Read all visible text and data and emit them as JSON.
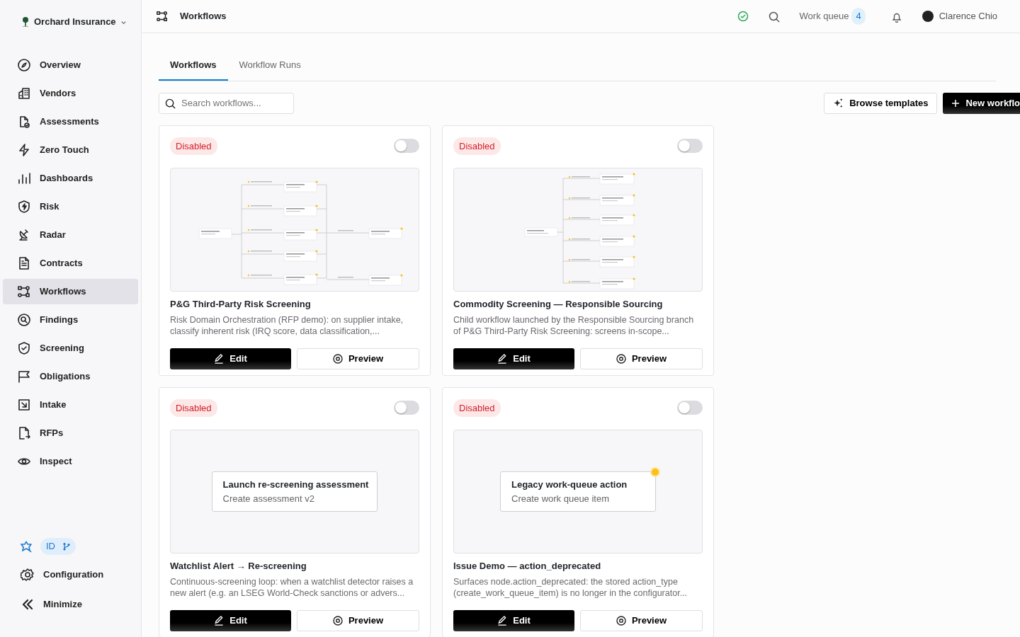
{
  "org": {
    "name": "Orchard Insurance"
  },
  "sidebar": {
    "items": [
      {
        "label": "Overview",
        "selected": false
      },
      {
        "label": "Vendors",
        "selected": false
      },
      {
        "label": "Assessments",
        "selected": false
      },
      {
        "label": "Zero Touch",
        "selected": false
      },
      {
        "label": "Dashboards",
        "selected": false
      },
      {
        "label": "Risk",
        "selected": false
      },
      {
        "label": "Radar",
        "selected": false
      },
      {
        "label": "Contracts",
        "selected": false
      },
      {
        "label": "Workflows",
        "selected": true
      },
      {
        "label": "Findings",
        "selected": false
      },
      {
        "label": "Screening",
        "selected": false
      },
      {
        "label": "Obligations",
        "selected": false
      },
      {
        "label": "Intake",
        "selected": false
      },
      {
        "label": "RFPs",
        "selected": false
      },
      {
        "label": "Inspect",
        "selected": false
      }
    ],
    "env_badge": "ID",
    "footer": [
      {
        "label": "Configuration"
      },
      {
        "label": "Minimize"
      }
    ]
  },
  "header": {
    "title": "Workflows",
    "work_queue": {
      "label": "Work queue",
      "count": "4"
    },
    "user": "Clarence Chio"
  },
  "tabs": [
    {
      "label": "Workflows",
      "selected": true
    },
    {
      "label": "Workflow Runs",
      "selected": false
    }
  ],
  "search": {
    "placeholder": "Search workflows..."
  },
  "buttons": {
    "browse": "Browse templates",
    "new": "New workflo"
  },
  "workflows": [
    {
      "status": "Disabled",
      "on": false,
      "preview": {
        "kind": "branching"
      },
      "title": "P&G Third-Party Risk Screening",
      "description": "Risk Domain Orchestration (RFP demo): on supplier intake, classify inherent risk (IRQ score, data classification,...",
      "edit": "Edit",
      "preview_button": "Preview"
    },
    {
      "status": "Disabled",
      "on": false,
      "preview": {
        "kind": "fan"
      },
      "title": "Commodity Screening — Responsible Sourcing",
      "description": "Child workflow launched by the Responsible Sourcing branch of P&G Third-Party Risk Screening: screens in-scope...",
      "edit": "Edit",
      "preview_button": "Preview"
    },
    {
      "status": "Disabled",
      "on": false,
      "preview": {
        "kind": "node",
        "title": "Launch re-screening assessment",
        "subtitle": "Create assessment v2",
        "warning": false
      },
      "title": "Watchlist Alert → Re-screening",
      "description": "Continuous-screening loop: when a watchlist detector raises a new alert (e.g. an LSEG World-Check sanctions or advers...",
      "edit": "Edit",
      "preview_button": "Preview"
    },
    {
      "status": "Disabled",
      "on": false,
      "preview": {
        "kind": "node",
        "title": "Legacy work-queue action",
        "subtitle": "Create work queue item",
        "warning": true
      },
      "title": "Issue Demo — action_deprecated",
      "description": "Surfaces node.action_deprecated: the stored action_type (create_work_queue_item) is no longer in the configurator...",
      "edit": "Edit",
      "preview_button": "Preview"
    }
  ]
}
